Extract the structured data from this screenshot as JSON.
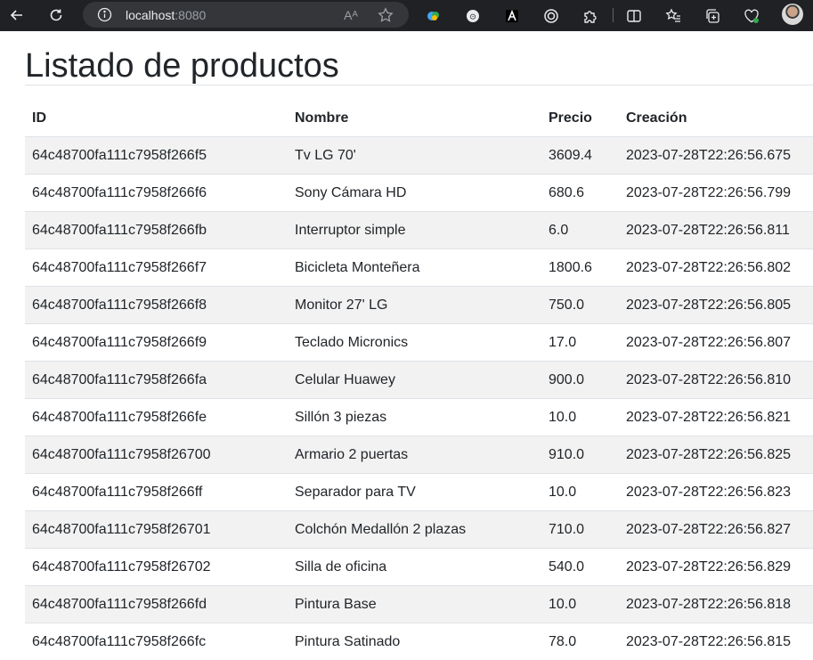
{
  "browser": {
    "url_host": "localhost",
    "url_port": ":8080"
  },
  "page": {
    "title": "Listado de productos"
  },
  "table": {
    "headers": [
      "ID",
      "Nombre",
      "Precio",
      "Creación"
    ],
    "rows": [
      [
        "64c48700fa111c7958f266f5",
        "Tv LG 70'",
        "3609.4",
        "2023-07-28T22:26:56.675"
      ],
      [
        "64c48700fa111c7958f266f6",
        "Sony Cámara HD",
        "680.6",
        "2023-07-28T22:26:56.799"
      ],
      [
        "64c48700fa111c7958f266fb",
        "Interruptor simple",
        "6.0",
        "2023-07-28T22:26:56.811"
      ],
      [
        "64c48700fa111c7958f266f7",
        "Bicicleta Monteñera",
        "1800.6",
        "2023-07-28T22:26:56.802"
      ],
      [
        "64c48700fa111c7958f266f8",
        "Monitor 27' LG",
        "750.0",
        "2023-07-28T22:26:56.805"
      ],
      [
        "64c48700fa111c7958f266f9",
        "Teclado Micronics",
        "17.0",
        "2023-07-28T22:26:56.807"
      ],
      [
        "64c48700fa111c7958f266fa",
        "Celular Huawey",
        "900.0",
        "2023-07-28T22:26:56.810"
      ],
      [
        "64c48700fa111c7958f266fe",
        "Sillón 3 piezas",
        "10.0",
        "2023-07-28T22:26:56.821"
      ],
      [
        "64c48700fa111c7958f26700",
        "Armario 2 puertas",
        "910.0",
        "2023-07-28T22:26:56.825"
      ],
      [
        "64c48700fa111c7958f266ff",
        "Separador para TV",
        "10.0",
        "2023-07-28T22:26:56.823"
      ],
      [
        "64c48700fa111c7958f26701",
        "Colchón Medallón 2 plazas",
        "710.0",
        "2023-07-28T22:26:56.827"
      ],
      [
        "64c48700fa111c7958f26702",
        "Silla de oficina",
        "540.0",
        "2023-07-28T22:26:56.829"
      ],
      [
        "64c48700fa111c7958f266fd",
        "Pintura Base",
        "10.0",
        "2023-07-28T22:26:56.818"
      ],
      [
        "64c48700fa111c7958f266fc",
        "Pintura Satinado",
        "78.0",
        "2023-07-28T22:26:56.815"
      ]
    ]
  },
  "icons": {
    "back": "back-arrow-icon",
    "refresh": "refresh-icon",
    "info": "site-info-icon",
    "read_aloud": "read-aloud-icon",
    "favorite": "favorite-star-icon",
    "extensions": [
      "extension-color-icon",
      "extension-circle-icon",
      "extension-a-icon",
      "extension-target-icon",
      "extensions-puzzle-icon"
    ],
    "split": "split-screen-icon",
    "favorites_list": "favorites-list-icon",
    "collections": "collections-icon",
    "health": "browser-essentials-icon",
    "profile": "profile-avatar"
  },
  "colors": {
    "toolbar_bg": "#202124",
    "address_bg": "#35363a",
    "stripe": "#f2f2f2",
    "border": "#dee2e6"
  }
}
